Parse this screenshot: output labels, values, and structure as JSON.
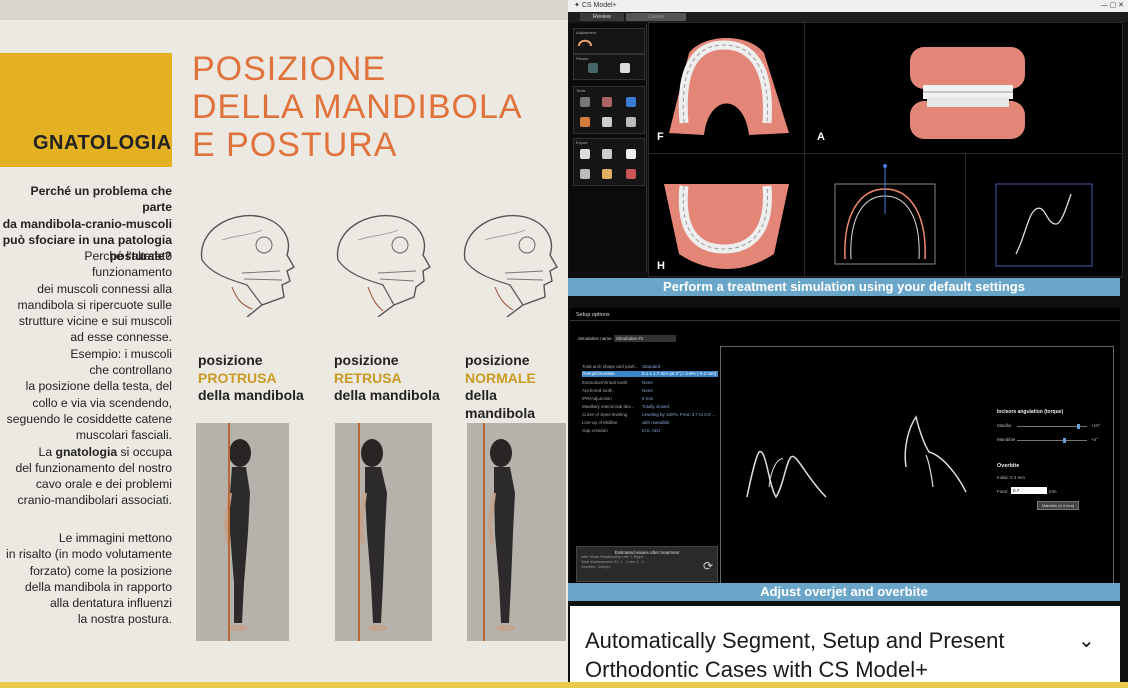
{
  "magazine": {
    "section": "GNATOLOGIA",
    "title": [
      "POSIZIONE",
      "DELLA MANDIBOLA",
      "E POSTURA"
    ],
    "question": [
      "Perché un problema che parte",
      "da mandibola-cranio-muscoli",
      "può sfociare in una patologia",
      "posturale?"
    ],
    "body1": [
      "Perché l'alterato funzionamento",
      "dei muscoli connessi alla",
      "mandibola si ripercuote sulle",
      "strutture vicine e sui muscoli",
      "ad esse connesse.",
      "Esempio: i muscoli",
      "che controllano",
      "la posizione della testa, del",
      "collo e via via scendendo,",
      "seguendo le cosiddette catene",
      "muscolari fasciali."
    ],
    "body2_prefix": "La ",
    "body2_bold": "gnatologia",
    "body2_suffix": " si occupa",
    "body2_rest": [
      "del funzionamento del nostro",
      "cavo orale e dei problemi",
      "cranio-mandibolari associati."
    ],
    "body3": [
      "Le immagini mettono",
      "in risalto (in modo volutamente",
      "forzato) come la posizione",
      "della mandibola in rapporto",
      "alla dentatura influenzi",
      "la nostra postura."
    ],
    "positions": [
      {
        "line1": "posizione",
        "kind": "PROTRUSA",
        "line3": "della mandibola"
      },
      {
        "line1": "posizione",
        "kind": "RETRUSA",
        "line3": "della mandibola"
      },
      {
        "line1": "posizione",
        "kind": "NORMALE",
        "line3": "della mandibola"
      }
    ]
  },
  "app": {
    "window_title": "CS Model+",
    "tabs": [
      "Review",
      "Cases"
    ],
    "sidebar": {
      "panel1": "Adjustment",
      "panel2": "Planes",
      "panel3": "Tools",
      "panel4": "Export"
    },
    "viewports": [
      "F",
      "A",
      "H"
    ],
    "banner1": "Perform a treatment simulation using your default settings",
    "setup": {
      "title": "Setup options",
      "sim_label": "Simulation name:",
      "sim_value": "Simulation #1",
      "options": [
        {
          "k": "Total arch shape and postl...",
          "v": "Standard"
        },
        {
          "k": "Overjet/Overbite",
          "v": "0.1 x 1.7 mm (at 0°) / 2.9% (-0.2 mm)"
        },
        {
          "k": "Extraction/Virtual tooth",
          "v": "None"
        },
        {
          "k": "Anchored tooth",
          "v": "None"
        },
        {
          "k": "IPR/Adjunction",
          "v": "0 mm"
        },
        {
          "k": "Maxillary interincisal dev...",
          "v": "Totally closed"
        },
        {
          "k": "Curve of Spee leveling",
          "v": "Leveling by 100%, From 3.7 to 0.0 ..."
        },
        {
          "k": "Line-up of Midline",
          "v": "with mandible"
        },
        {
          "k": "Gap creation",
          "v": "ICS, ADJ"
        }
      ],
      "estimated": "Estimated values after treatment",
      "est_lines": [
        "Inter Molar Relationship Left: 1 Right:",
        "Total displacement (T):   1 - 1 mm  1 - 1",
        "Overbite:   Overjet:"
      ],
      "incisors_title": "Incisors angulation (torque)",
      "maxilla": "Maxilla",
      "mandible": "Mandible",
      "maxilla_val": "+10°",
      "mandible_val": "+4°",
      "overbite_title": "Overbite",
      "initial": "Initial:   0.4   mm",
      "final_label": "Final:",
      "final_value": "0.7",
      "final_unit": "mm",
      "maintain_btn": "Maintain (0.4 mm)"
    },
    "banner2": "Adjust overjet and overbite",
    "footer_title": "Automatically Segment, Setup and Present Orthodontic Cases with CS Model+"
  }
}
